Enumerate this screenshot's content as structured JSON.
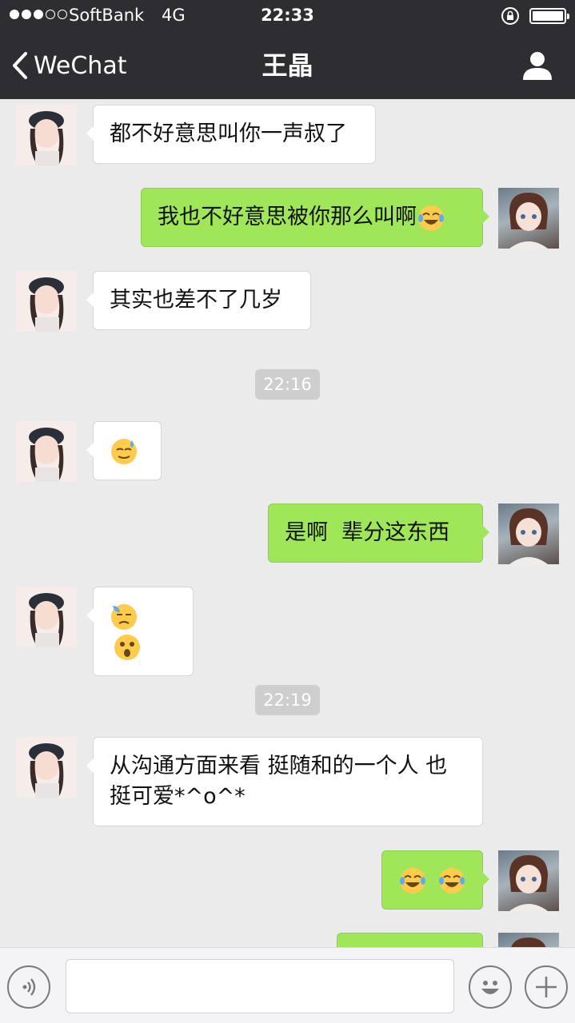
{
  "status_bar": {
    "carrier": "SoftBank",
    "network": "4G",
    "time": "22:33"
  },
  "nav": {
    "back_label": "WeChat",
    "title": "王晶"
  },
  "messages": [
    {
      "side": "in",
      "text": "都不好意思叫你一声叔了"
    },
    {
      "side": "out",
      "text": "我也不好意思被你那么叫啊",
      "emojis": [
        "joy-tears-emoji"
      ]
    },
    {
      "side": "in",
      "text": "其实也差不了几岁"
    },
    {
      "type": "time",
      "text": "22:16"
    },
    {
      "side": "in",
      "emojis": [
        "sweat-smile-emoji"
      ]
    },
    {
      "side": "out",
      "text": "是啊  辈分这东西"
    },
    {
      "side": "in",
      "emojis": [
        "downcast-sweat-emoji",
        "astonished-emoji"
      ]
    },
    {
      "type": "time",
      "text": "22:19"
    },
    {
      "side": "in",
      "text_line1": "从沟通方面来看 挺随和的一个人 也",
      "text_line2": "挺可爱*^o^*"
    },
    {
      "side": "out",
      "emojis": [
        "joy-tears-emoji",
        "joy-tears-emoji"
      ]
    }
  ],
  "input": {
    "placeholder": ""
  },
  "colors": {
    "nav_bg": "#2e2e32",
    "chat_bg": "#ebebeb",
    "bubble_out": "#9fe658",
    "bubble_in": "#ffffff",
    "timestamp_bg": "#cecece"
  },
  "icons": [
    "back-chevron-icon",
    "profile-icon",
    "voice-icon",
    "emoji-icon",
    "plus-icon",
    "lock-rotation-icon",
    "battery-icon"
  ]
}
